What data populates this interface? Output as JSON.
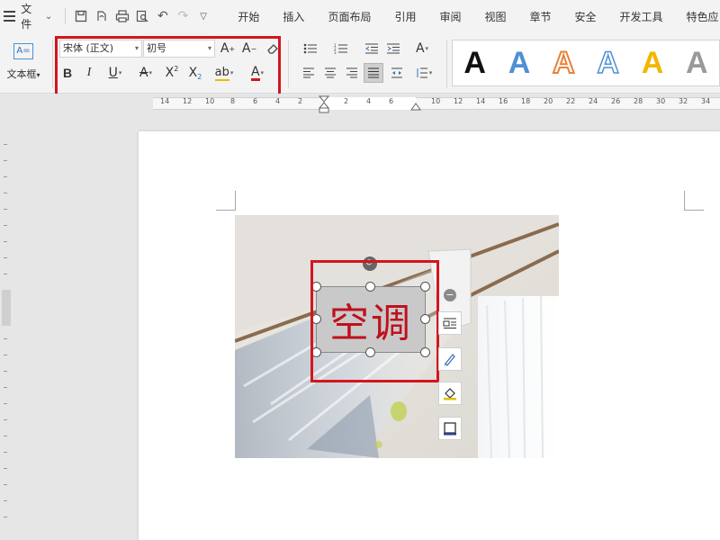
{
  "menubar": {
    "file_label": "文件",
    "tabs": [
      "开始",
      "插入",
      "页面布局",
      "引用",
      "审阅",
      "视图",
      "章节",
      "安全",
      "开发工具",
      "特色应"
    ]
  },
  "ribbon": {
    "textbox_label": "文本框",
    "font_name": "宋体 (正文)",
    "font_size": "初号"
  },
  "ruler": {
    "labels": [
      "14",
      "12",
      "10",
      "8",
      "6",
      "4",
      "2",
      "2",
      "4",
      "6",
      "10",
      "12",
      "14",
      "16",
      "18",
      "20",
      "22",
      "24",
      "26",
      "28",
      "30",
      "32",
      "34"
    ]
  },
  "document": {
    "textbox_text": "空调"
  },
  "colors": {
    "highlight_red": "#d4151d",
    "text_red": "#c0101d"
  },
  "style_gallery": {
    "letter": "A"
  }
}
